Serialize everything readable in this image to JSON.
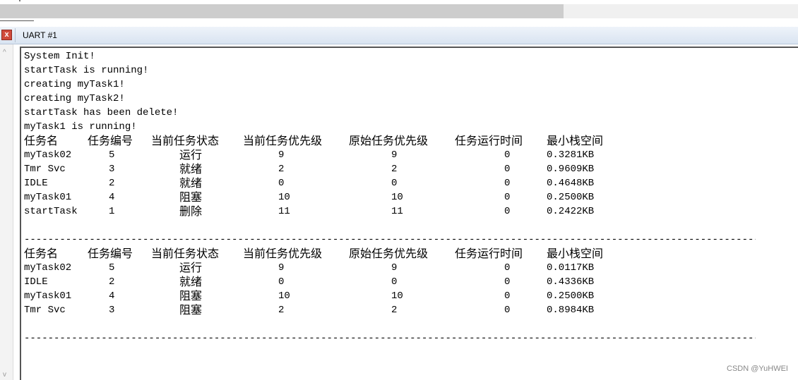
{
  "window": {
    "title": "UART #1",
    "close_glyph": "x"
  },
  "terminal": {
    "log_lines": [
      "System Init!",
      "startTask is running!",
      "creating myTask1!",
      "creating myTask2!",
      "startTask has been delete!",
      "myTask1 is running!"
    ],
    "headers": [
      "任务名",
      "任务编号",
      "当前任务状态",
      "当前任务优先级",
      "原始任务优先级",
      "任务运行时间",
      "最小栈空间"
    ],
    "table1": [
      [
        "myTask02",
        "5",
        "运行",
        "9",
        "9",
        "0",
        "0.3281KB"
      ],
      [
        "Tmr Svc",
        "3",
        "就绪",
        "2",
        "2",
        "0",
        "0.9609KB"
      ],
      [
        "IDLE",
        "2",
        "就绪",
        "0",
        "0",
        "0",
        "0.4648KB"
      ],
      [
        "myTask01",
        "4",
        "阻塞",
        "10",
        "10",
        "0",
        "0.2500KB"
      ],
      [
        "startTask",
        "1",
        "删除",
        "11",
        "11",
        "0",
        "0.2422KB"
      ]
    ],
    "table2": [
      [
        "myTask02",
        "5",
        "运行",
        "9",
        "9",
        "0",
        "0.0117KB"
      ],
      [
        "IDLE",
        "2",
        "就绪",
        "0",
        "0",
        "0",
        "0.4336KB"
      ],
      [
        "myTask01",
        "4",
        "阻塞",
        "10",
        "10",
        "0",
        "0.2500KB"
      ],
      [
        "Tmr Svc",
        "3",
        "阻塞",
        "2",
        "2",
        "0",
        "0.8984KB"
      ]
    ],
    "separator": "-----------------------------------------------------------------------------------------------------------------------------------------"
  },
  "watermark": "CSDN @YuHWEI",
  "icons": {
    "close": "close-icon",
    "scroll_up": "scroll-up-arrow-icon",
    "scroll_down": "scroll-down-arrow-icon"
  },
  "colors": {
    "close_button": "#d04a3c",
    "titlebar": "#dde7f3"
  }
}
